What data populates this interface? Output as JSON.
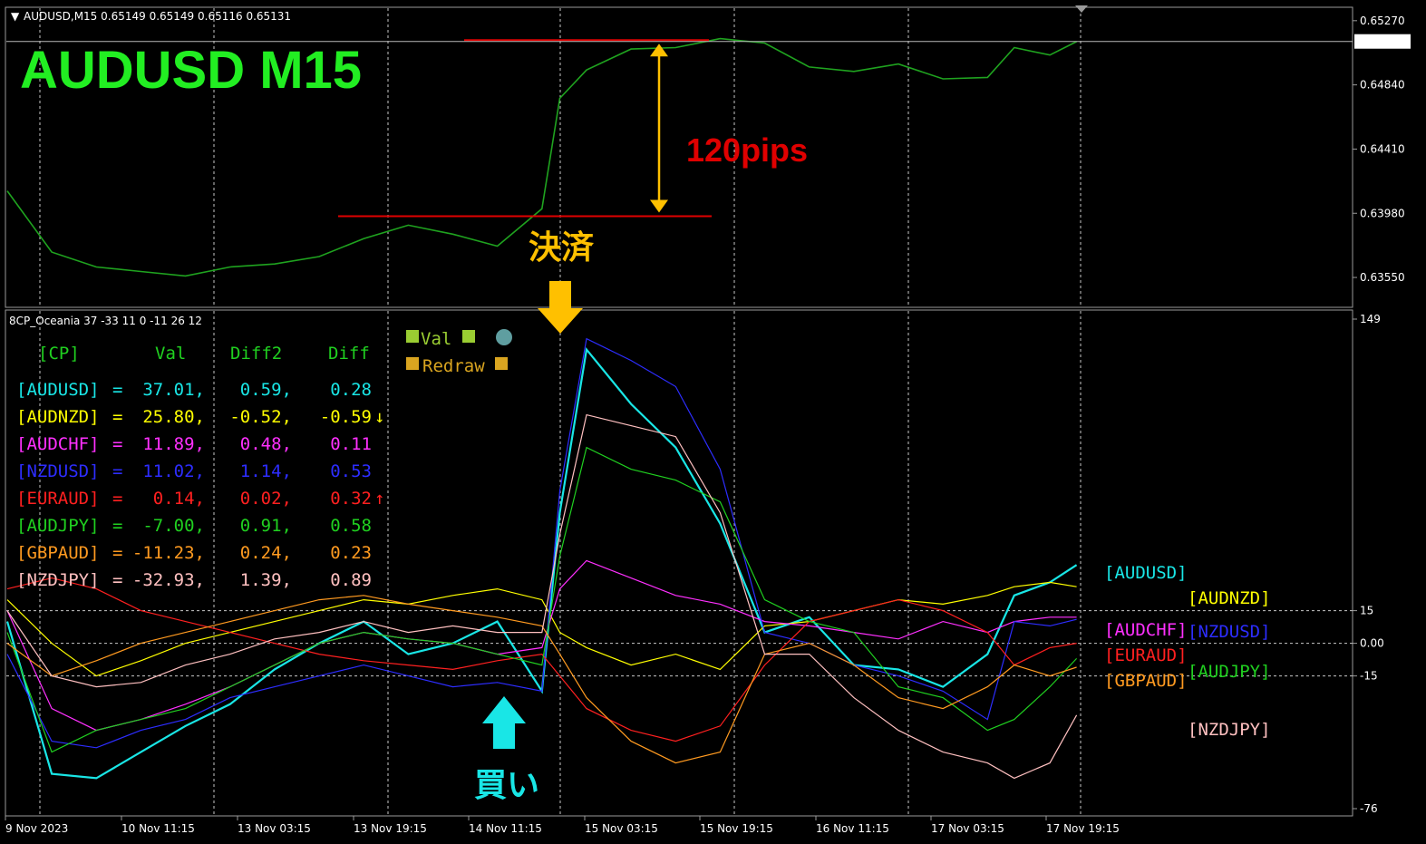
{
  "header": {
    "symbol_info": "AUDUSD,M15  0.65149 0.65149 0.65116 0.65131",
    "big_title": "AUDUSD  M15",
    "indicator_info": "8CP_Oceania 37 -33 11 0 -11 26 12"
  },
  "annotations": {
    "pips_label": "120pips",
    "close_label": "決済",
    "buy_label": "買い"
  },
  "colors": {
    "price_line": "#1fa31f",
    "annotation_red": "#e00000",
    "arrow_yellow": "#ffc000",
    "arrow_cyan": "#19e6e6",
    "grid": "#c8c8c8"
  },
  "time_labels": [
    "9 Nov 2023",
    "10 Nov 11:15",
    "13 Nov 03:15",
    "13 Nov 19:15",
    "14 Nov 11:15",
    "15 Nov 03:15",
    "15 Nov 19:15",
    "16 Nov 11:15",
    "17 Nov 03:15",
    "17 Nov 19:15"
  ],
  "chart_data": [
    {
      "type": "line",
      "title": "AUDUSD,M15",
      "y_ticks": [
        "0.65270",
        "0.64840",
        "0.64410",
        "0.63980",
        "0.63550"
      ],
      "current_price": "0.65131",
      "ylim": [
        0.6335,
        0.6536
      ],
      "x_index": [
        0,
        5,
        10,
        15,
        20,
        25,
        30,
        35,
        40,
        45,
        50,
        55,
        60,
        62,
        65,
        70,
        75,
        80,
        85,
        90,
        95,
        100,
        105,
        110,
        113,
        117,
        120
      ],
      "series": [
        {
          "values": [
            0.6413,
            0.6372,
            0.6362,
            0.6359,
            0.6356,
            0.6362,
            0.6364,
            0.6369,
            0.6381,
            0.639,
            0.6384,
            0.6376,
            0.6401,
            0.6475,
            0.6494,
            0.6508,
            0.6509,
            0.6515,
            0.6512,
            0.6496,
            0.6493,
            0.6498,
            0.6488,
            0.6489,
            0.6509,
            0.6504,
            0.6513
          ]
        }
      ],
      "levels": [
        {
          "value": 0.6514
        },
        {
          "value": 0.6396
        }
      ]
    },
    {
      "type": "line",
      "title": "8CP_Oceania",
      "y_ticks": [
        "149",
        "15",
        "0.00",
        "-15",
        "-76"
      ],
      "ylim": [
        -76,
        149
      ],
      "x_index": [
        0,
        5,
        10,
        15,
        20,
        25,
        30,
        35,
        40,
        45,
        50,
        55,
        60,
        62,
        65,
        70,
        75,
        80,
        85,
        90,
        95,
        100,
        105,
        110,
        113,
        117,
        120
      ],
      "columns": [
        "[CP]",
        "Val",
        "Diff2",
        "Diff"
      ],
      "legend_widgets": [
        "Val",
        "Redraw"
      ],
      "series": [
        {
          "name": "[AUDUSD]",
          "color": "#19e6e6",
          "val": "37.01,",
          "diff2": "0.59,",
          "diff": "0.28",
          "arrow": "",
          "values": [
            10,
            -60,
            -62,
            -50,
            -38,
            -28,
            -12,
            0,
            10,
            -5,
            0,
            10,
            -22,
            60,
            135,
            110,
            90,
            55,
            5,
            12,
            -10,
            -12,
            -20,
            -5,
            22,
            28,
            36
          ]
        },
        {
          "name": "[AUDNZD]",
          "color": "#ffff00",
          "val": "25.80,",
          "diff2": "-0.52,",
          "diff": "-0.59",
          "arrow": "↓",
          "values": [
            20,
            0,
            -15,
            -8,
            0,
            5,
            10,
            15,
            20,
            18,
            22,
            25,
            20,
            5,
            -2,
            -10,
            -5,
            -12,
            8,
            10,
            15,
            20,
            18,
            22,
            26,
            28,
            26
          ]
        },
        {
          "name": "[AUDCHF]",
          "color": "#ff30ff",
          "val": "11.89,",
          "diff2": "0.48,",
          "diff": "0.11",
          "arrow": "",
          "values": [
            15,
            -30,
            -40,
            -35,
            -28,
            -20,
            -10,
            0,
            5,
            2,
            0,
            -5,
            -2,
            25,
            38,
            30,
            22,
            18,
            10,
            8,
            5,
            2,
            10,
            5,
            10,
            12,
            12
          ]
        },
        {
          "name": "[NZDUSD]",
          "color": "#2d2dff",
          "val": "11.02,",
          "diff2": "1.14,",
          "diff": "0.53",
          "arrow": "",
          "values": [
            -5,
            -45,
            -48,
            -40,
            -35,
            -25,
            -20,
            -15,
            -10,
            -15,
            -20,
            -18,
            -22,
            70,
            140,
            130,
            118,
            80,
            5,
            0,
            -10,
            -15,
            -22,
            -35,
            10,
            8,
            11
          ]
        },
        {
          "name": "[EURAUD]",
          "color": "#ff2020",
          "val": "0.14,",
          "diff2": "0.02,",
          "diff": "0.32",
          "arrow": "↑",
          "values": [
            25,
            30,
            25,
            15,
            10,
            5,
            0,
            -5,
            -8,
            -10,
            -12,
            -8,
            -5,
            -15,
            -30,
            -40,
            -45,
            -38,
            -10,
            10,
            15,
            20,
            15,
            5,
            -10,
            -2,
            0
          ]
        },
        {
          "name": "[AUDJPY]",
          "color": "#20d020",
          "val": "-7.00,",
          "diff2": "0.91,",
          "diff": "0.58",
          "arrow": "",
          "values": [
            5,
            -50,
            -40,
            -35,
            -30,
            -20,
            -10,
            0,
            5,
            2,
            0,
            -5,
            -10,
            40,
            90,
            80,
            75,
            65,
            20,
            10,
            5,
            -20,
            -25,
            -40,
            -35,
            -20,
            -7
          ]
        },
        {
          "name": "[GBPAUD]",
          "color": "#ff9a20",
          "val": "-11.23,",
          "diff2": "0.24,",
          "diff": "0.23",
          "arrow": "",
          "values": [
            0,
            -15,
            -8,
            0,
            5,
            10,
            15,
            20,
            22,
            18,
            15,
            12,
            8,
            -5,
            -25,
            -45,
            -55,
            -50,
            -5,
            0,
            -10,
            -25,
            -30,
            -20,
            -10,
            -15,
            -11
          ]
        },
        {
          "name": "[NZDJPY]",
          "color": "#ffc0c0",
          "val": "-32.93,",
          "diff2": "1.39,",
          "diff": "0.89",
          "arrow": "",
          "values": [
            15,
            -15,
            -20,
            -18,
            -10,
            -5,
            2,
            5,
            10,
            5,
            8,
            5,
            5,
            50,
            105,
            100,
            95,
            60,
            -5,
            -5,
            -25,
            -40,
            -50,
            -55,
            -62,
            -55,
            -33
          ]
        }
      ],
      "right_labels": [
        "[AUDUSD]",
        "[AUDNZD]",
        "[AUDCHF]",
        "[NZDUSD]",
        "[EURAUD]",
        "[AUDJPY]",
        "[GBPAUD]",
        "[NZDJPY]"
      ]
    }
  ]
}
